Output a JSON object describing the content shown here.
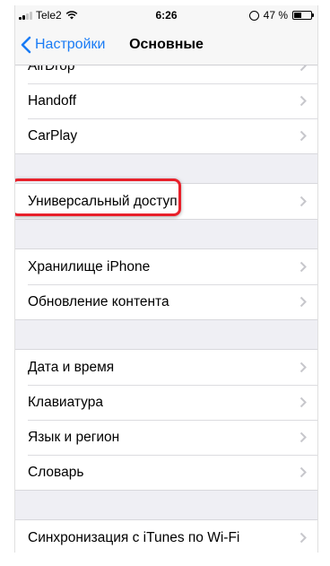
{
  "status_bar": {
    "carrier": "Tele2",
    "time": "6:26",
    "battery_percent": "47 %",
    "battery_level": 0.47
  },
  "nav": {
    "back_label": "Настройки",
    "title": "Основные"
  },
  "groups": [
    {
      "items": [
        "AirDrop",
        "Handoff",
        "CarPlay"
      ]
    },
    {
      "items": [
        "Универсальный доступ"
      ],
      "highlighted": true
    },
    {
      "items": [
        "Хранилище iPhone",
        "Обновление контента"
      ]
    },
    {
      "items": [
        "Дата и время",
        "Клавиатура",
        "Язык и регион",
        "Словарь"
      ]
    },
    {
      "items": [
        "Синхронизация с iTunes по Wi-Fi"
      ]
    }
  ],
  "colors": {
    "accent": "#1a7cf5",
    "highlight_border": "#e8202a",
    "background": "#efeff4"
  }
}
